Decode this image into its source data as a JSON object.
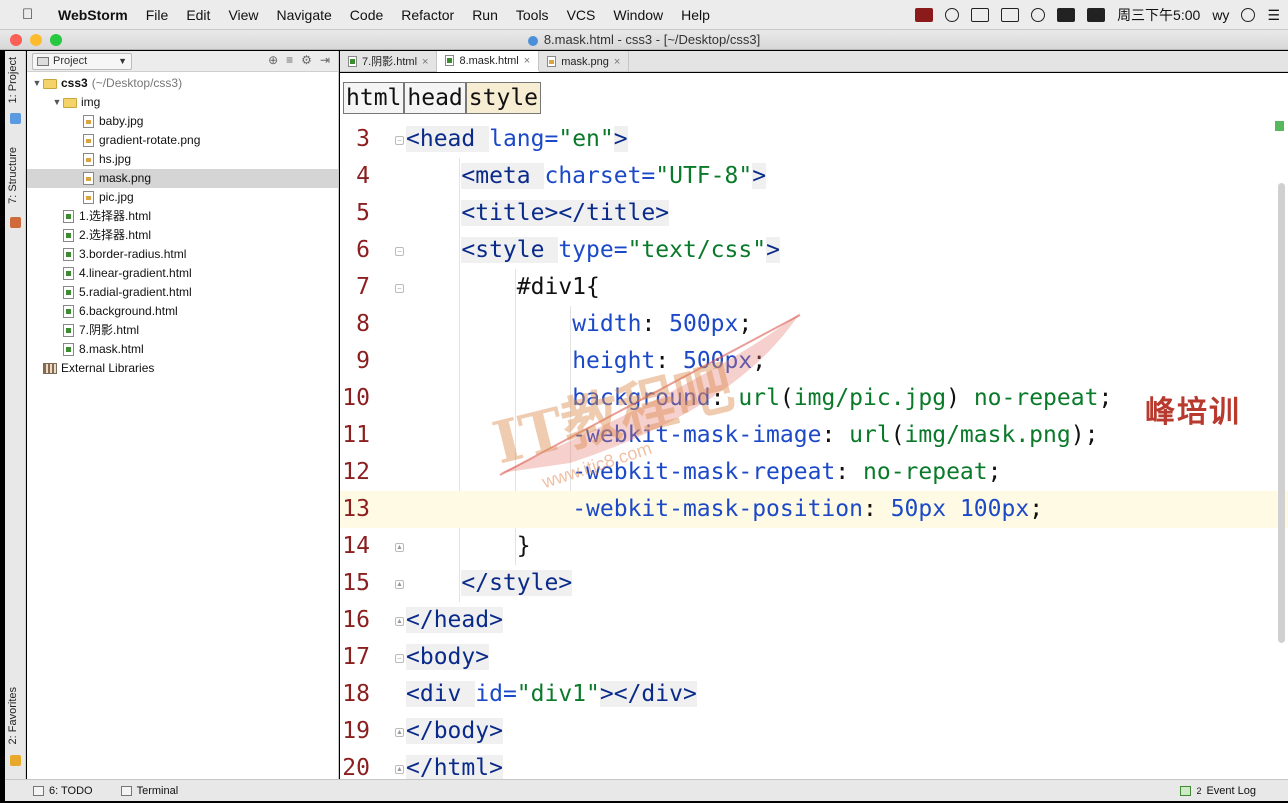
{
  "menubar": {
    "app_name": "WebStorm",
    "items": [
      "File",
      "Edit",
      "View",
      "Navigate",
      "Code",
      "Refactor",
      "Run",
      "Tools",
      "VCS",
      "Window",
      "Help"
    ],
    "clock": "周三下午5:00",
    "user": "wy"
  },
  "window": {
    "title": "8.mask.html - css3 - [~/Desktop/css3]"
  },
  "left_strip": {
    "project_tab": "1: Project",
    "structure_tab": "7: Structure",
    "favorites_tab": "2: Favorites"
  },
  "project_panel": {
    "view_label": "Project",
    "tree": [
      {
        "kind": "folder",
        "depth": 0,
        "expanded": true,
        "label": "css3",
        "note": "(~/Desktop/css3)",
        "bold": true
      },
      {
        "kind": "folder",
        "depth": 1,
        "expanded": true,
        "label": "img"
      },
      {
        "kind": "image",
        "depth": 2,
        "label": "baby.jpg"
      },
      {
        "kind": "image",
        "depth": 2,
        "label": "gradient-rotate.png"
      },
      {
        "kind": "image",
        "depth": 2,
        "label": "hs.jpg"
      },
      {
        "kind": "image",
        "depth": 2,
        "label": "mask.png",
        "selected": true
      },
      {
        "kind": "image",
        "depth": 2,
        "label": "pic.jpg"
      },
      {
        "kind": "html",
        "depth": 1,
        "label": "1.选择器.html"
      },
      {
        "kind": "html",
        "depth": 1,
        "label": "2.选择器.html"
      },
      {
        "kind": "html",
        "depth": 1,
        "label": "3.border-radius.html"
      },
      {
        "kind": "html",
        "depth": 1,
        "label": "4.linear-gradient.html"
      },
      {
        "kind": "html",
        "depth": 1,
        "label": "5.radial-gradient.html"
      },
      {
        "kind": "html",
        "depth": 1,
        "label": "6.background.html"
      },
      {
        "kind": "html",
        "depth": 1,
        "label": "7.阴影.html"
      },
      {
        "kind": "html",
        "depth": 1,
        "label": "8.mask.html"
      },
      {
        "kind": "library",
        "depth": 0,
        "label": "External Libraries"
      }
    ]
  },
  "tabs": [
    {
      "label": "7.阴影.html",
      "icon": "html-file-icon",
      "active": false
    },
    {
      "label": "8.mask.html",
      "icon": "html-file-icon",
      "active": true
    },
    {
      "label": "mask.png",
      "icon": "image-file-icon",
      "active": false
    }
  ],
  "breadcrumbs": [
    "html",
    "head",
    "style"
  ],
  "code_lines": [
    {
      "n": "3",
      "fold": "open",
      "indent": 0,
      "parts": [
        [
          "tg",
          "<head "
        ],
        [
          "at",
          "lang="
        ],
        [
          "sv",
          "\"en\""
        ],
        [
          "tg",
          ">"
        ]
      ]
    },
    {
      "n": "4",
      "indent": 1,
      "parts": [
        [
          "tg",
          "<meta "
        ],
        [
          "at",
          "charset="
        ],
        [
          "sv",
          "\"UTF-8\""
        ],
        [
          "tg",
          ">"
        ]
      ]
    },
    {
      "n": "5",
      "indent": 1,
      "parts": [
        [
          "tg",
          "<title></title>"
        ]
      ]
    },
    {
      "n": "6",
      "fold": "open",
      "indent": 1,
      "parts": [
        [
          "tg",
          "<style "
        ],
        [
          "at",
          "type="
        ],
        [
          "sv",
          "\"text/css\""
        ],
        [
          "tg",
          ">"
        ]
      ]
    },
    {
      "n": "7",
      "fold": "open",
      "indent": 2,
      "parts": [
        [
          "sel",
          "#div1{"
        ]
      ]
    },
    {
      "n": "8",
      "indent": 3,
      "parts": [
        [
          "prop",
          "width"
        ],
        [
          "sel",
          ": "
        ],
        [
          "num",
          "500px"
        ],
        [
          "sel",
          ";"
        ]
      ]
    },
    {
      "n": "9",
      "indent": 3,
      "parts": [
        [
          "prop",
          "height"
        ],
        [
          "sel",
          ": "
        ],
        [
          "num",
          "500px"
        ],
        [
          "sel",
          ";"
        ]
      ]
    },
    {
      "n": "10",
      "indent": 3,
      "parts": [
        [
          "prop",
          "background"
        ],
        [
          "sel",
          ": "
        ],
        [
          "sv",
          "url"
        ],
        [
          "sel",
          "("
        ],
        [
          "sv",
          "img/pic.jpg"
        ],
        [
          "sel",
          ") "
        ],
        [
          "sv",
          "no-repeat"
        ],
        [
          "sel",
          ";"
        ]
      ]
    },
    {
      "n": "11",
      "indent": 3,
      "parts": [
        [
          "prop",
          "-webkit-mask-image"
        ],
        [
          "sel",
          ": "
        ],
        [
          "sv",
          "url"
        ],
        [
          "sel",
          "("
        ],
        [
          "sv",
          "img/mask.png"
        ],
        [
          "sel",
          ");"
        ]
      ]
    },
    {
      "n": "12",
      "indent": 3,
      "parts": [
        [
          "prop",
          "-webkit-mask-repeat"
        ],
        [
          "sel",
          ": "
        ],
        [
          "sv",
          "no-repeat"
        ],
        [
          "sel",
          ";"
        ]
      ]
    },
    {
      "n": "13",
      "indent": 3,
      "current": true,
      "parts": [
        [
          "prop",
          "-webkit-mask-position"
        ],
        [
          "sel",
          ": "
        ],
        [
          "num",
          "50px"
        ],
        [
          "sel",
          " "
        ],
        [
          "num",
          "100px"
        ],
        [
          "sel",
          ";"
        ]
      ]
    },
    {
      "n": "14",
      "fold": "close",
      "indent": 2,
      "parts": [
        [
          "sel",
          "}"
        ]
      ]
    },
    {
      "n": "15",
      "fold": "close",
      "indent": 1,
      "parts": [
        [
          "tg",
          "</style>"
        ]
      ]
    },
    {
      "n": "16",
      "fold": "close",
      "indent": 0,
      "parts": [
        [
          "tg",
          "</head>"
        ]
      ]
    },
    {
      "n": "17",
      "fold": "open",
      "indent": 0,
      "parts": [
        [
          "tg",
          "<body>"
        ]
      ]
    },
    {
      "n": "18",
      "indent": 0,
      "parts": [
        [
          "tg",
          "<div "
        ],
        [
          "at",
          "id="
        ],
        [
          "sv",
          "\"div1\""
        ],
        [
          "tg",
          "></div>"
        ]
      ]
    },
    {
      "n": "19",
      "fold": "close",
      "indent": 0,
      "parts": [
        [
          "tg",
          "</body>"
        ]
      ]
    },
    {
      "n": "20",
      "fold": "close",
      "indent": 0,
      "parts": [
        [
          "tg",
          "</html>"
        ]
      ]
    }
  ],
  "watermark": {
    "brand_cn": "峰培训",
    "logo_text": "IT教程吧",
    "logo_url": "www.itjc8.com"
  },
  "bottombar": {
    "todo": "6: TODO",
    "terminal": "Terminal",
    "event_log": "Event Log",
    "event_count": "2"
  },
  "colors": {
    "line_number": "#8b1e1e",
    "tag": "#0a2a8a",
    "attribute": "#1c49c7",
    "string": "#0a7a2a",
    "current_line": "#fffae3"
  }
}
